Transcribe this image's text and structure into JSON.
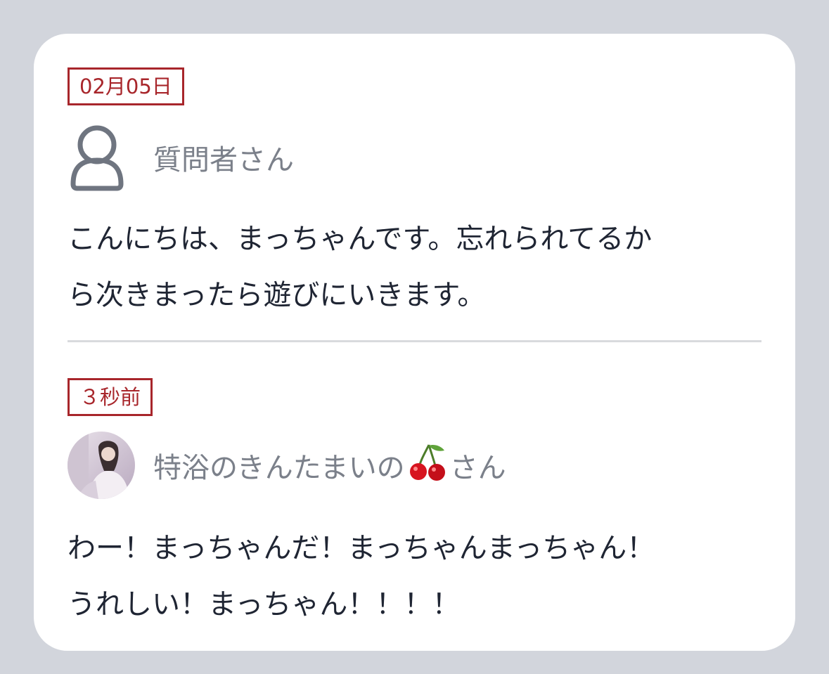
{
  "posts": [
    {
      "date": "02月05日",
      "author": "質問者さん",
      "avatar": "person-outline-icon",
      "lines": [
        "こんにちは、まっちゃんです。忘れられてるか",
        "ら次きまったら遊びにいきます。"
      ]
    },
    {
      "date": "３秒前",
      "author_prefix": "特浴のきんたまいの",
      "author_emoji": "cherry-emoji-icon",
      "author_suffix": "さん",
      "avatar": "user-photo-avatar",
      "lines": [
        "わー！まっちゃんだ！まっちゃんまっちゃん！",
        "うれしい！まっちゃん！！！！"
      ]
    }
  ],
  "colors": {
    "background": "#d2d5dc",
    "card": "#ffffff",
    "badge": "#a8262b",
    "author": "#7b808a",
    "text": "#1f2533"
  }
}
